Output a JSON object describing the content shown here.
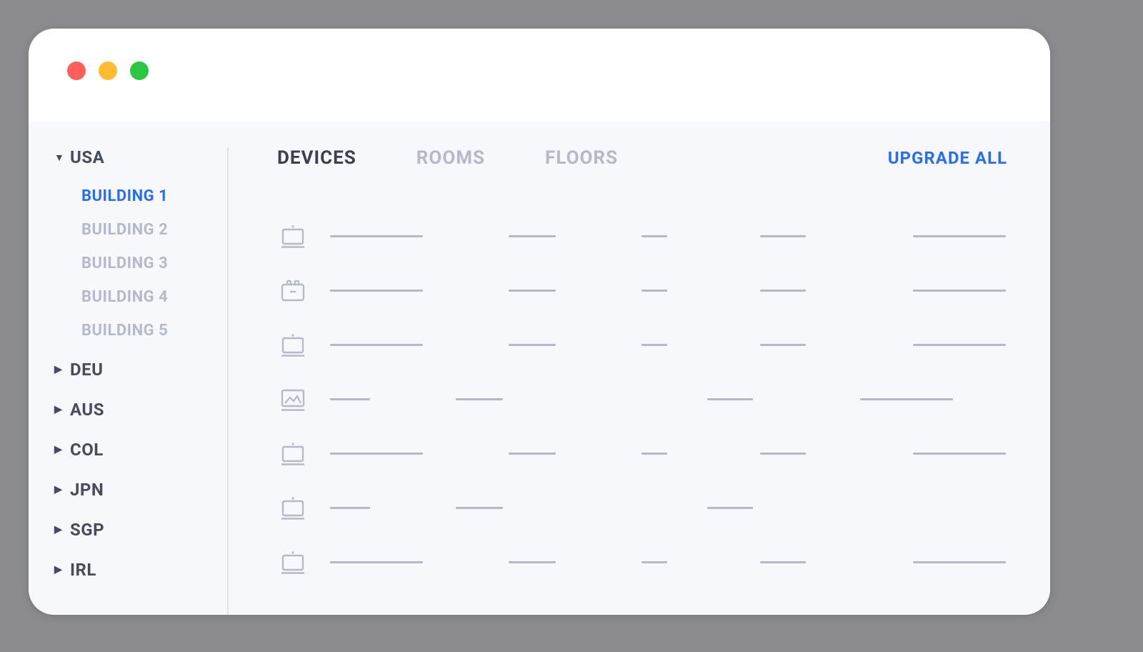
{
  "sidebar": {
    "regions": [
      {
        "code": "USA",
        "expanded": true,
        "children": [
          {
            "label": "BUILDING 1",
            "active": true
          },
          {
            "label": "BUILDING 2",
            "active": false
          },
          {
            "label": "BUILDING 3",
            "active": false
          },
          {
            "label": "BUILDING 4",
            "active": false
          },
          {
            "label": "BUILDING 5",
            "active": false
          }
        ]
      },
      {
        "code": "DEU",
        "expanded": false
      },
      {
        "code": "AUS",
        "expanded": false
      },
      {
        "code": "COL",
        "expanded": false
      },
      {
        "code": "JPN",
        "expanded": false
      },
      {
        "code": "SGP",
        "expanded": false
      },
      {
        "code": "IRL",
        "expanded": false
      }
    ]
  },
  "tabs": [
    {
      "label": "DEVICES",
      "active": true
    },
    {
      "label": "ROOMS",
      "active": false
    },
    {
      "label": "FLOORS",
      "active": false
    }
  ],
  "actions": {
    "upgrade_all": "UPGRADE ALL"
  },
  "devices": [
    {
      "icon": "display",
      "c1": "long",
      "c2": true,
      "c3": true,
      "c4": true,
      "c5": true
    },
    {
      "icon": "case",
      "c1": "long",
      "c2": true,
      "c3": true,
      "c4": true,
      "c5": true
    },
    {
      "icon": "display",
      "c1": "long",
      "c2": true,
      "c3": true,
      "c4": true,
      "c5": true
    },
    {
      "icon": "image",
      "c1": "short",
      "c2": true,
      "c3": false,
      "c4": true,
      "c5": true
    },
    {
      "icon": "display",
      "c1": "long",
      "c2": true,
      "c3": true,
      "c4": true,
      "c5": true
    },
    {
      "icon": "display",
      "c1": "short",
      "c2": true,
      "c3": false,
      "c4": true,
      "c5": false
    },
    {
      "icon": "display",
      "c1": "long",
      "c2": true,
      "c3": true,
      "c4": true,
      "c5": true
    }
  ],
  "colors": {
    "accent": "#2a6df4",
    "muted": "#b5b9c9",
    "text": "#3a3f52"
  }
}
